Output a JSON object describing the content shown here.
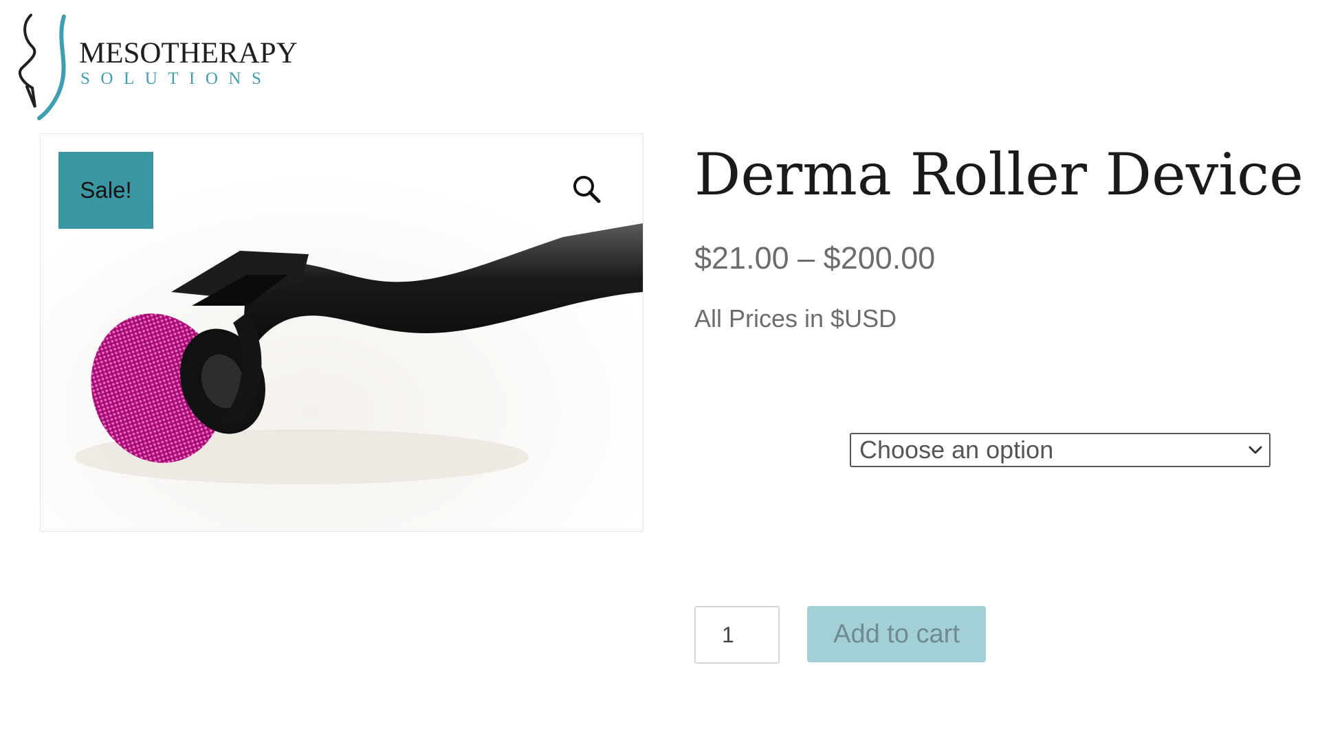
{
  "logo": {
    "wordmark": "MESOTHERAPY",
    "tagline": "SOLUTIONS",
    "colors": {
      "dark": "#1f1f1f",
      "accent": "#3e9fb2"
    }
  },
  "gallery": {
    "sale_badge": "Sale!",
    "zoom_icon": "search-icon",
    "badge_color": "#3b96a3"
  },
  "product": {
    "title": "Derma Roller Device",
    "price_range": "$21.00 – $200.00",
    "price_note": "All Prices in $USD"
  },
  "variation": {
    "selected": "Choose an option"
  },
  "cart": {
    "quantity": "1",
    "add_to_cart_label": "Add to cart",
    "button_color": "#a3d0d6"
  }
}
